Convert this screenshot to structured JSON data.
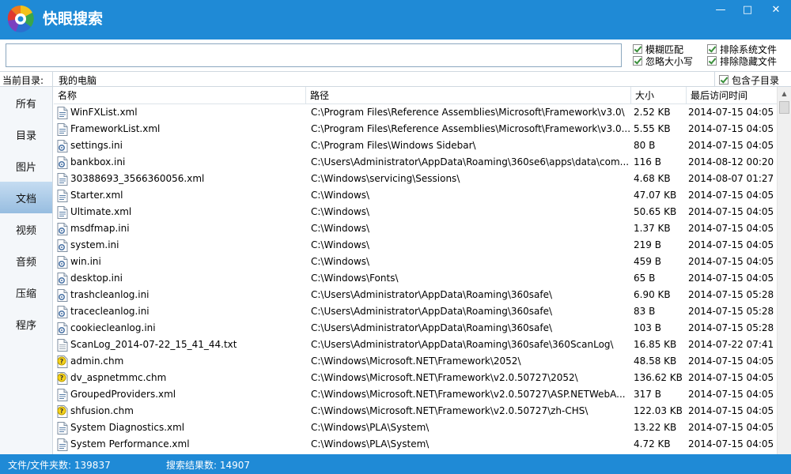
{
  "window": {
    "title": "快眼搜索",
    "controls": {
      "minimize": "—",
      "maximize": "□",
      "close": "✕"
    }
  },
  "search": {
    "value": "",
    "placeholder": ""
  },
  "options": {
    "fuzzy": "模糊匹配",
    "ignore_case": "忽略大小写",
    "exclude_system": "排除系统文件",
    "exclude_hidden": "排除隐藏文件",
    "include_subdirs": "包含子目录"
  },
  "current_dir": {
    "label": "当前目录:",
    "value": "我的电脑"
  },
  "sidebar": {
    "items": [
      {
        "label": "所有"
      },
      {
        "label": "目录"
      },
      {
        "label": "图片"
      },
      {
        "label": "文档"
      },
      {
        "label": "视频"
      },
      {
        "label": "音频"
      },
      {
        "label": "压缩"
      },
      {
        "label": "程序"
      }
    ],
    "active_index": 3
  },
  "table": {
    "columns": [
      "名称",
      "路径",
      "大小",
      "最后访问时间"
    ],
    "rows": [
      {
        "icon": "xml-file-icon",
        "name": "WinFXList.xml",
        "path": "C:\\Program Files\\Reference Assemblies\\Microsoft\\Framework\\v3.0\\",
        "size": "2.52 KB",
        "time": "2014-07-15 04:05"
      },
      {
        "icon": "xml-file-icon",
        "name": "FrameworkList.xml",
        "path": "C:\\Program Files\\Reference Assemblies\\Microsoft\\Framework\\v3.0...",
        "size": "5.55 KB",
        "time": "2014-07-15 04:05"
      },
      {
        "icon": "ini-file-icon",
        "name": "settings.ini",
        "path": "C:\\Program Files\\Windows Sidebar\\",
        "size": "80 B",
        "time": "2014-07-15 04:05"
      },
      {
        "icon": "ini-file-icon",
        "name": "bankbox.ini",
        "path": "C:\\Users\\Administrator\\AppData\\Roaming\\360se6\\apps\\data\\com...",
        "size": "116 B",
        "time": "2014-08-12 00:20"
      },
      {
        "icon": "xml-file-icon",
        "name": "30388693_3566360056.xml",
        "path": "C:\\Windows\\servicing\\Sessions\\",
        "size": "4.68 KB",
        "time": "2014-08-07 01:27"
      },
      {
        "icon": "xml-file-icon",
        "name": "Starter.xml",
        "path": "C:\\Windows\\",
        "size": "47.07 KB",
        "time": "2014-07-15 04:05"
      },
      {
        "icon": "xml-file-icon",
        "name": "Ultimate.xml",
        "path": "C:\\Windows\\",
        "size": "50.65 KB",
        "time": "2014-07-15 04:05"
      },
      {
        "icon": "ini-file-icon",
        "name": "msdfmap.ini",
        "path": "C:\\Windows\\",
        "size": "1.37 KB",
        "time": "2014-07-15 04:05"
      },
      {
        "icon": "ini-file-icon",
        "name": "system.ini",
        "path": "C:\\Windows\\",
        "size": "219 B",
        "time": "2014-07-15 04:05"
      },
      {
        "icon": "ini-file-icon",
        "name": "win.ini",
        "path": "C:\\Windows\\",
        "size": "459 B",
        "time": "2014-07-15 04:05"
      },
      {
        "icon": "ini-file-icon",
        "name": "desktop.ini",
        "path": "C:\\Windows\\Fonts\\",
        "size": "65 B",
        "time": "2014-07-15 04:05"
      },
      {
        "icon": "ini-file-icon",
        "name": "trashcleanlog.ini",
        "path": "C:\\Users\\Administrator\\AppData\\Roaming\\360safe\\",
        "size": "6.90 KB",
        "time": "2014-07-15 05:28"
      },
      {
        "icon": "ini-file-icon",
        "name": "tracecleanlog.ini",
        "path": "C:\\Users\\Administrator\\AppData\\Roaming\\360safe\\",
        "size": "83 B",
        "time": "2014-07-15 05:28"
      },
      {
        "icon": "ini-file-icon",
        "name": "cookiecleanlog.ini",
        "path": "C:\\Users\\Administrator\\AppData\\Roaming\\360safe\\",
        "size": "103 B",
        "time": "2014-07-15 05:28"
      },
      {
        "icon": "txt-file-icon",
        "name": "ScanLog_2014-07-22_15_41_44.txt",
        "path": "C:\\Users\\Administrator\\AppData\\Roaming\\360safe\\360ScanLog\\",
        "size": "16.85 KB",
        "time": "2014-07-22 07:41"
      },
      {
        "icon": "chm-file-icon",
        "name": "admin.chm",
        "path": "C:\\Windows\\Microsoft.NET\\Framework\\2052\\",
        "size": "48.58 KB",
        "time": "2014-07-15 04:05"
      },
      {
        "icon": "chm-file-icon",
        "name": "dv_aspnetmmc.chm",
        "path": "C:\\Windows\\Microsoft.NET\\Framework\\v2.0.50727\\2052\\",
        "size": "136.62 KB",
        "time": "2014-07-15 04:05"
      },
      {
        "icon": "xml-file-icon",
        "name": "GroupedProviders.xml",
        "path": "C:\\Windows\\Microsoft.NET\\Framework\\v2.0.50727\\ASP.NETWebA...",
        "size": "317 B",
        "time": "2014-07-15 04:05"
      },
      {
        "icon": "chm-file-icon",
        "name": "shfusion.chm",
        "path": "C:\\Windows\\Microsoft.NET\\Framework\\v2.0.50727\\zh-CHS\\",
        "size": "122.03 KB",
        "time": "2014-07-15 04:05"
      },
      {
        "icon": "xml-file-icon",
        "name": "System Diagnostics.xml",
        "path": "C:\\Windows\\PLA\\System\\",
        "size": "13.22 KB",
        "time": "2014-07-15 04:05"
      },
      {
        "icon": "xml-file-icon",
        "name": "System Performance.xml",
        "path": "C:\\Windows\\PLA\\System\\",
        "size": "4.72 KB",
        "time": "2014-07-15 04:05"
      }
    ]
  },
  "status": {
    "files_count": "文件/文件夹数: 139837",
    "result_count": "搜索结果数: 14907"
  },
  "colors": {
    "titlebar": "#1f8ad6",
    "statusbar": "#1f8ad6",
    "sidebar_active": "#a8c8e8"
  }
}
